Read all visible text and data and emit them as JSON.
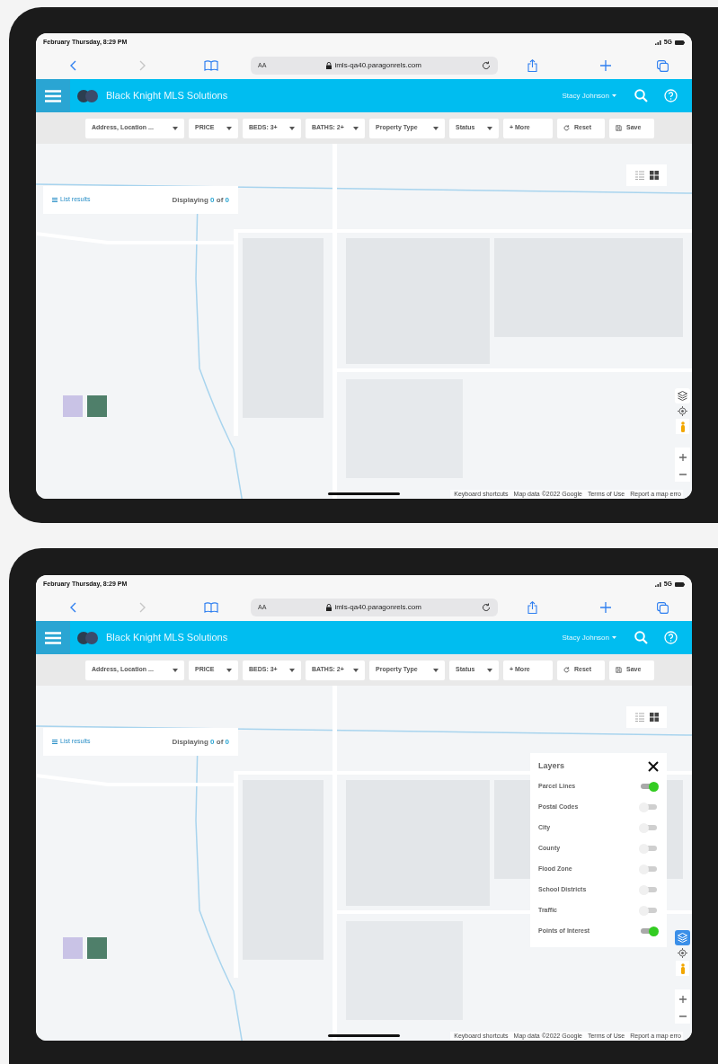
{
  "screens": [
    {
      "status_bar": {
        "time": "February Thursday, 8:29 PM",
        "network": "5G"
      },
      "browser": {
        "text_size": "AA",
        "url": "imls-qa40.paragonrels.com"
      },
      "app_header": {
        "title": "Black Knight MLS Solutions",
        "user": "Stacy Johnson"
      },
      "filters": [
        {
          "label": "Address, Location ...",
          "kind": "dropdown"
        },
        {
          "label": "PRICE",
          "kind": "dropdown"
        },
        {
          "label": "BEDS: 3+",
          "kind": "dropdown"
        },
        {
          "label": "BATHS: 2+",
          "kind": "dropdown"
        },
        {
          "label": "Property Type",
          "kind": "dropdown"
        },
        {
          "label": "Status",
          "kind": "dropdown"
        },
        {
          "label": "+ More",
          "kind": "button"
        },
        {
          "label": "Reset",
          "kind": "reset"
        },
        {
          "label": "Save",
          "kind": "save"
        }
      ],
      "results": {
        "link": "List results",
        "prefix": "Displaying",
        "shown": "0",
        "middle": "of",
        "total": "0"
      },
      "views": [
        {
          "kind": "list",
          "selected": false
        },
        {
          "kind": "grid",
          "selected": true
        }
      ],
      "map": {
        "kind": "picture",
        "layers_button": {
          "selected": false
        },
        "footer": [
          "Keyboard shortcuts",
          "Map data ©2022 Google",
          "Terms of Use",
          "Report a map erro"
        ]
      }
    },
    {
      "status_bar": {
        "time": "February Thursday, 8:29 PM",
        "network": "5G"
      },
      "browser": {
        "text_size": "AA",
        "url": "imls-qa40.paragonrels.com"
      },
      "app_header": {
        "title": "Black Knight MLS Solutions",
        "user": "Stacy Johnson"
      },
      "filters": [
        {
          "label": "Address, Location ...",
          "kind": "dropdown"
        },
        {
          "label": "PRICE",
          "kind": "dropdown"
        },
        {
          "label": "BEDS: 3+",
          "kind": "dropdown"
        },
        {
          "label": "BATHS: 2+",
          "kind": "dropdown"
        },
        {
          "label": "Property Type",
          "kind": "dropdown"
        },
        {
          "label": "Status",
          "kind": "dropdown"
        },
        {
          "label": "+ More",
          "kind": "button"
        },
        {
          "label": "Reset",
          "kind": "reset"
        },
        {
          "label": "Save",
          "kind": "save"
        }
      ],
      "results": {
        "link": "List results",
        "prefix": "Displaying",
        "shown": "0",
        "middle": "of",
        "total": "0"
      },
      "views": [
        {
          "kind": "list",
          "selected": false
        },
        {
          "kind": "grid",
          "selected": true
        }
      ],
      "map": {
        "kind": "picture",
        "layers_button": {
          "selected": true
        },
        "footer": [
          "Keyboard shortcuts",
          "Map data ©2022 Google",
          "Terms of Use",
          "Report a map erro"
        ]
      },
      "layers_panel": {
        "title": "Layers",
        "items": [
          {
            "label": "Parcel Lines",
            "on": true
          },
          {
            "label": "Postal Codes",
            "on": false
          },
          {
            "label": "City",
            "on": false
          },
          {
            "label": "County",
            "on": false
          },
          {
            "label": "Flood Zone",
            "on": false
          },
          {
            "label": "School Districts",
            "on": false
          },
          {
            "label": "Traffic",
            "on": false
          },
          {
            "label": "Points of Interest",
            "on": true
          }
        ]
      }
    }
  ]
}
